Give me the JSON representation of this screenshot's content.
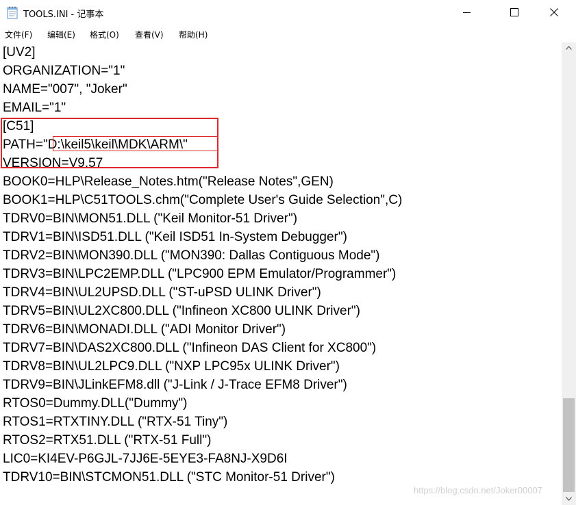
{
  "window": {
    "title": "TOOLS.INI - 记事本",
    "icon": "notepad-icon"
  },
  "menu": [
    {
      "label": "文件(F)"
    },
    {
      "label": "编辑(E)"
    },
    {
      "label": "格式(O)"
    },
    {
      "label": "查看(V)"
    },
    {
      "label": "帮助(H)"
    }
  ],
  "lines": [
    "[UV2]",
    "ORGANIZATION=\"1\"",
    "NAME=\"007\", \"Joker\"",
    "EMAIL=\"1\"",
    "[C51]",
    "PATH=\"D:\\keil5\\keil\\MDK\\ARM\\\"",
    "VERSION=V9.57",
    "BOOK0=HLP\\Release_Notes.htm(\"Release Notes\",GEN)",
    "BOOK1=HLP\\C51TOOLS.chm(\"Complete User's Guide Selection\",C)",
    "TDRV0=BIN\\MON51.DLL (\"Keil Monitor-51 Driver\")",
    "TDRV1=BIN\\ISD51.DLL (\"Keil ISD51 In-System Debugger\")",
    "TDRV2=BIN\\MON390.DLL (\"MON390: Dallas Contiguous Mode\")",
    "TDRV3=BIN\\LPC2EMP.DLL (\"LPC900 EPM Emulator/Programmer\")",
    "TDRV4=BIN\\UL2UPSD.DLL (\"ST-uPSD ULINK Driver\")",
    "TDRV5=BIN\\UL2XC800.DLL (\"Infineon XC800 ULINK Driver\")",
    "TDRV6=BIN\\MONADI.DLL (\"ADI Monitor Driver\")",
    "TDRV7=BIN\\DAS2XC800.DLL (\"Infineon DAS Client for XC800\")",
    "TDRV8=BIN\\UL2LPC9.DLL (\"NXP LPC95x ULINK Driver\")",
    "TDRV9=BIN\\JLinkEFM8.dll (\"J-Link / J-Trace EFM8 Driver\")",
    "RTOS0=Dummy.DLL(\"Dummy\")",
    "RTOS1=RTXTINY.DLL (\"RTX-51 Tiny\")",
    "RTOS2=RTX51.DLL (\"RTX-51 Full\")",
    "LIC0=KI4EV-P6GJL-7JJ6E-5EYE3-FA8NJ-X9D6I",
    "TDRV10=BIN\\STCMON51.DLL (\"STC Monitor-51 Driver\")"
  ],
  "watermark": "https://blog.csdn.net/Joker00007",
  "colors": {
    "annotation": "#e0282a",
    "scrollbar_track": "#f0f0f0",
    "scrollbar_thumb": "#c2c2c2"
  }
}
